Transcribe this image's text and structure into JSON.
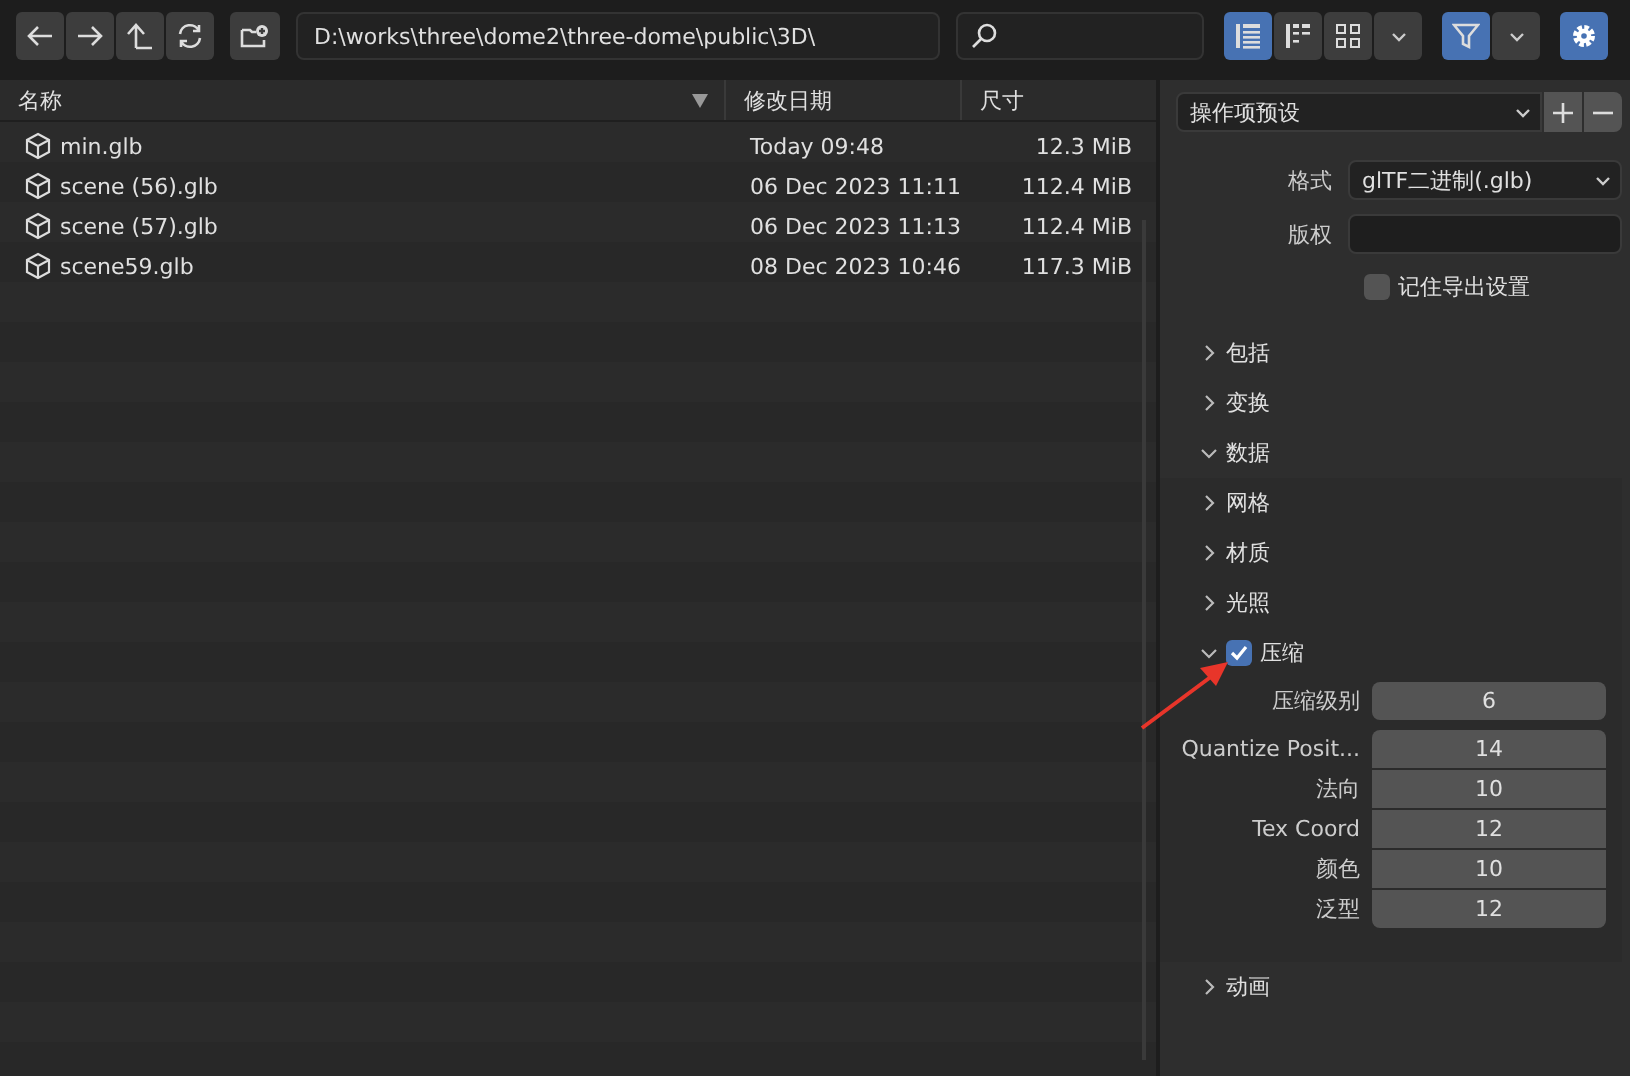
{
  "toolbar": {
    "path": "D:\\works\\three\\dome2\\three-dome\\public\\3D\\",
    "view_modes": [
      {
        "selected": true
      },
      {
        "selected": false
      },
      {
        "selected": false
      }
    ],
    "filter": {
      "on": true
    }
  },
  "file_list": {
    "columns": [
      "名称",
      "修改日期",
      "尺寸"
    ],
    "rows": [
      {
        "name": "min.glb",
        "date": "Today 09:48",
        "size": "12.3 MiB"
      },
      {
        "name": "scene (56).glb",
        "date": "06 Dec 2023 11:11",
        "size": "112.4 MiB"
      },
      {
        "name": "scene (57).glb",
        "date": "06 Dec 2023 11:13",
        "size": "112.4 MiB"
      },
      {
        "name": "scene59.glb",
        "date": "08 Dec 2023 10:46",
        "size": "117.3 MiB"
      }
    ]
  },
  "panel": {
    "preset": "操作项预设",
    "fields": [
      {
        "kind": "dropdown",
        "label": "格式",
        "value": "glTF二进制(.glb)"
      },
      {
        "kind": "text",
        "label": "版权"
      }
    ],
    "remember": {
      "label": "记住导出设置",
      "checked": false
    },
    "sections": [
      {
        "label": "包括",
        "expanded": false
      },
      {
        "label": "变换",
        "expanded": false
      },
      {
        "label": "数据",
        "expanded": true,
        "children": [
          {
            "label": "网格",
            "expanded": false
          },
          {
            "label": "材质",
            "expanded": false
          },
          {
            "label": "光照",
            "expanded": false
          },
          {
            "label": "压缩",
            "expanded": true,
            "checked": true,
            "field_groups": [
              [
                {
                  "label": "压缩级别",
                  "value": "6"
                }
              ],
              [
                {
                  "label": "Quantize Posit...",
                  "value": "14"
                },
                {
                  "label": "法向",
                  "value": "10"
                },
                {
                  "label": "Tex Coord",
                  "value": "12"
                },
                {
                  "label": "颜色",
                  "value": "10"
                },
                {
                  "label": "泛型",
                  "value": "12"
                }
              ]
            ]
          }
        ]
      },
      {
        "label": "动画",
        "expanded": false
      }
    ]
  }
}
